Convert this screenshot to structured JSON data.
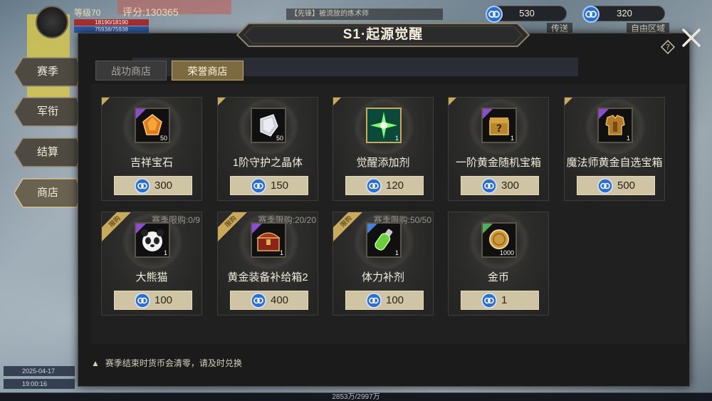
{
  "hud": {
    "level": "等级70",
    "power": "评分:130365",
    "hp": "18190/18190",
    "mp": "75938/75938",
    "chat": "【先锋】被流放的炼术师",
    "transmit": "传送",
    "free_zone": "自由区域",
    "date": "2025-04-17",
    "time": "19:00:16",
    "xp": "2853万/2997万"
  },
  "currency": [
    {
      "icon": "blue-coin-icon",
      "value": "530"
    },
    {
      "icon": "blue-coin-icon",
      "value": "320"
    }
  ],
  "title": "S1·起源觉醒",
  "side_tabs": [
    {
      "label": "赛季"
    },
    {
      "label": "军衔"
    },
    {
      "label": "结算"
    },
    {
      "label": "商店"
    }
  ],
  "shop_tabs": [
    {
      "label": "战功商店",
      "active": false
    },
    {
      "label": "荣誉商店",
      "active": true
    }
  ],
  "items": [
    {
      "name": "吉祥宝石",
      "qty": "50",
      "price": "300",
      "icon": "gem-icon",
      "quality": "purple"
    },
    {
      "name": "1阶守护之晶体",
      "qty": "50",
      "price": "150",
      "icon": "crystal-icon",
      "quality": "none"
    },
    {
      "name": "觉醒添加剂",
      "qty": "1",
      "price": "120",
      "icon": "sparkle-icon",
      "quality": "none"
    },
    {
      "name": "一阶黄金随机宝箱",
      "qty": "1",
      "price": "300",
      "icon": "random-chest-icon",
      "quality": "purple"
    },
    {
      "name": "魔法师黄金自选宝箱",
      "qty": "1",
      "price": "500",
      "icon": "armor-chest-icon",
      "quality": "purple"
    },
    {
      "name": "大熊猫",
      "qty": "1",
      "price": "100",
      "icon": "panda-icon",
      "quality": "purple",
      "limit_badge": "限购",
      "limit": "赛季限购:0/9"
    },
    {
      "name": "黄金装备补给箱2",
      "qty": "1",
      "price": "400",
      "icon": "treasure-chest-icon",
      "quality": "purple",
      "limit_badge": "限购",
      "limit": "赛季限购:20/20"
    },
    {
      "name": "体力补剂",
      "qty": "1",
      "price": "100",
      "icon": "potion-icon",
      "quality": "blue",
      "limit_badge": "限购",
      "limit": "赛季限购:50/50"
    },
    {
      "name": "金币",
      "qty": "1000",
      "price": "1",
      "icon": "gold-coin-icon",
      "quality": "green"
    }
  ],
  "footer_note": "赛季结束时货币会清零，请及时兑换",
  "colors": {
    "accent_gold": "#c9a95a",
    "price_bg": "#cfc4a4",
    "panel_bg": "#1b1b1c"
  }
}
